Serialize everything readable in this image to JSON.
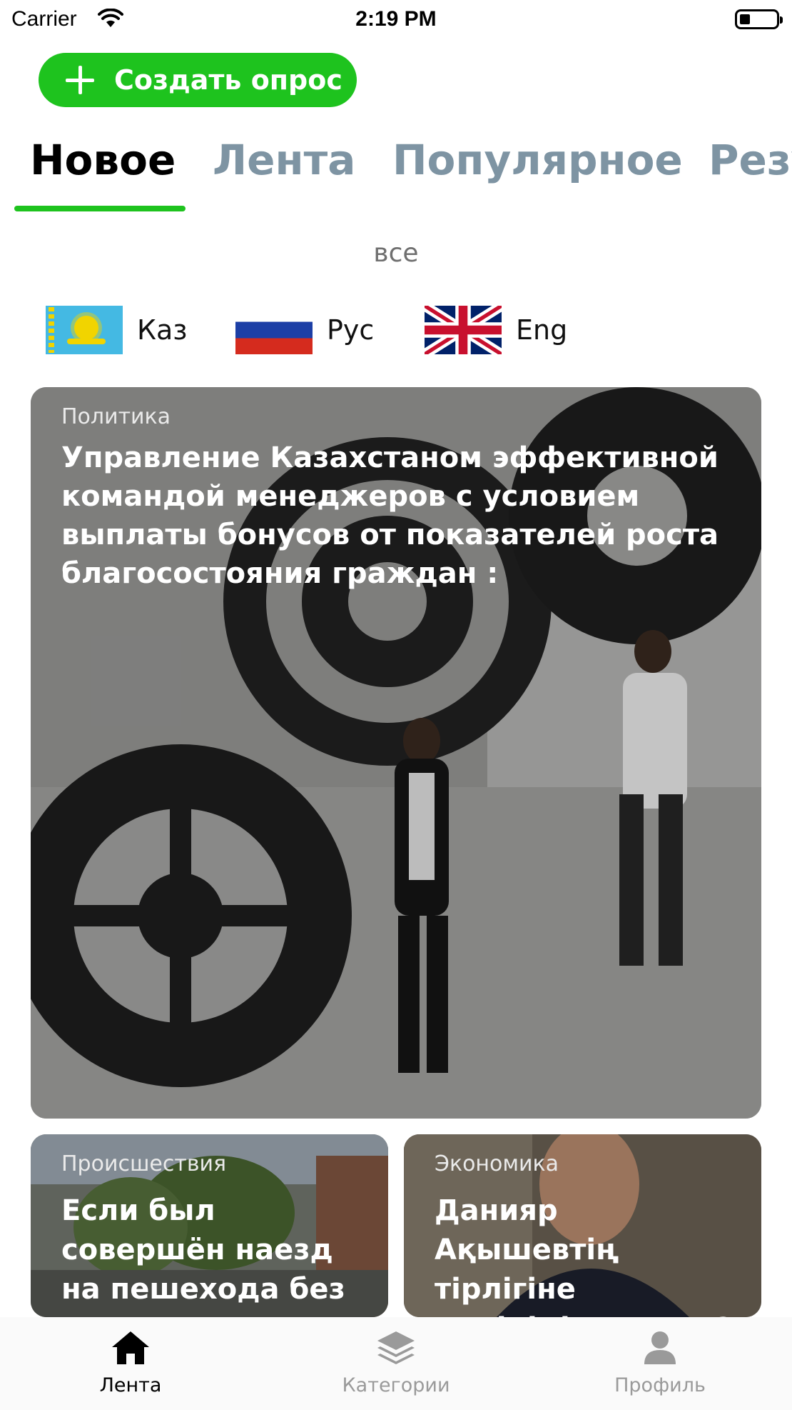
{
  "status_bar": {
    "carrier": "Carrier",
    "time": "2:19 PM"
  },
  "create_poll": {
    "label": "Создать опрос"
  },
  "tabs": [
    {
      "label": "Новое",
      "active": true
    },
    {
      "label": "Лента",
      "active": false
    },
    {
      "label": "Популярное",
      "active": false
    },
    {
      "label": "Результаты",
      "active": false
    }
  ],
  "filter": {
    "label": "все"
  },
  "languages": [
    {
      "code": "kz",
      "label": "Каз"
    },
    {
      "code": "ru",
      "label": "Рус"
    },
    {
      "code": "en",
      "label": "Eng"
    }
  ],
  "cards": [
    {
      "category": "Политика",
      "title": "Управление Казахстаном эффективной командой менеджеров с условием выплаты бонусов от показателей роста благосостояния граждан :"
    },
    {
      "category": "Происшествия",
      "title": " Если был совершён наезд на пешехода без"
    },
    {
      "category": "Экономика",
      "title": "Данияр Ақышевтің тірлігіне көңіліңіз толама?"
    }
  ],
  "tabbar": [
    {
      "label": "Лента",
      "icon": "home-icon",
      "active": true
    },
    {
      "label": "Категории",
      "icon": "layers-icon",
      "active": false
    },
    {
      "label": "Профиль",
      "icon": "person-icon",
      "active": false
    }
  ],
  "colors": {
    "accent": "#1ec31e",
    "inactive_tab": "#7e94a3"
  }
}
